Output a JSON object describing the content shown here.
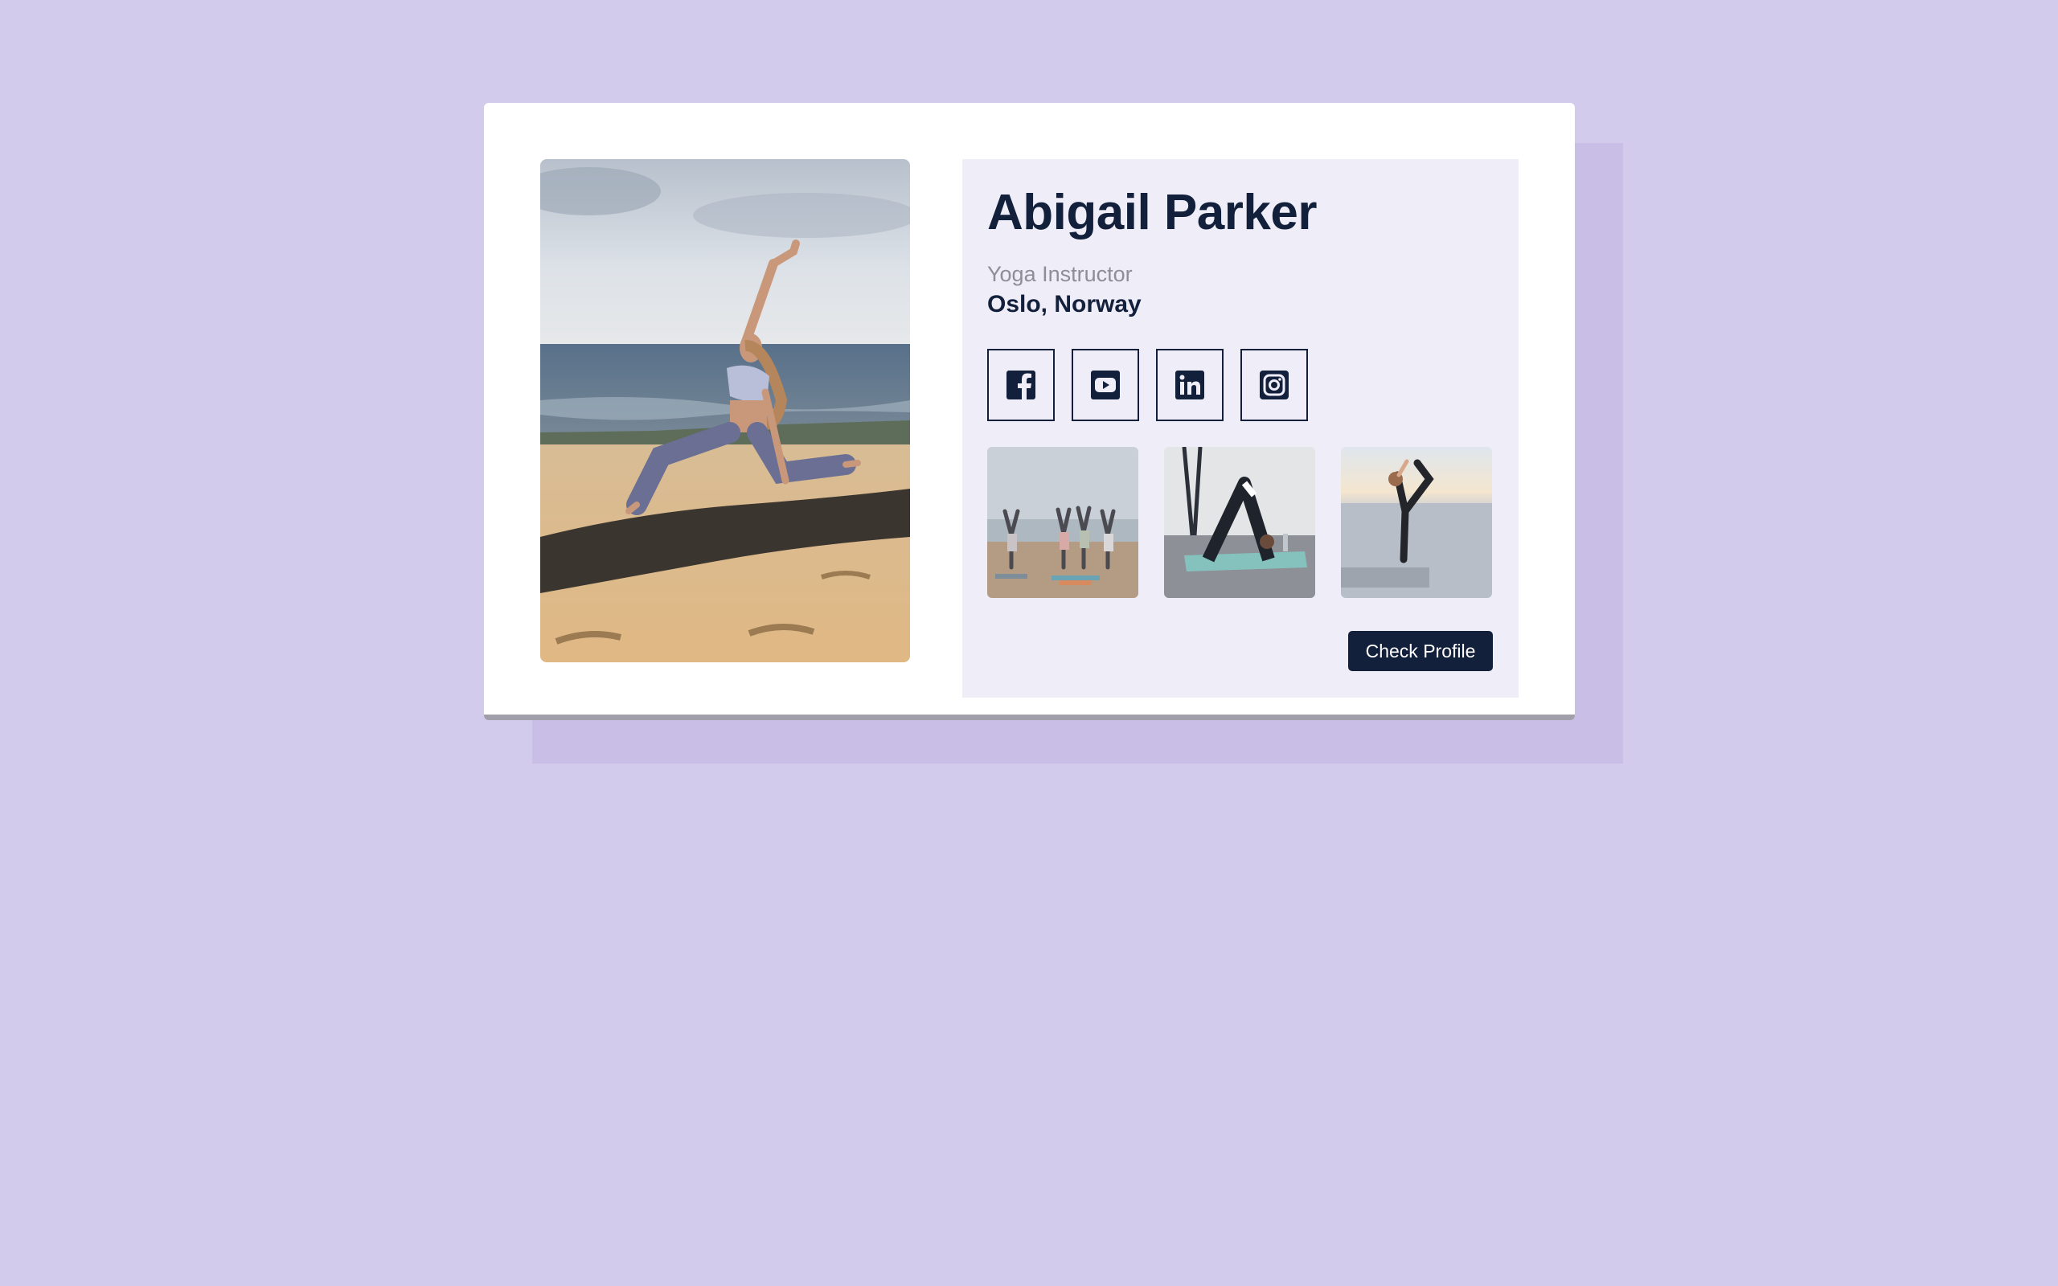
{
  "profile": {
    "name": "Abigail Parker",
    "role": "Yoga Instructor",
    "location": "Oslo, Norway"
  },
  "socials": [
    {
      "icon": "facebook-icon"
    },
    {
      "icon": "youtube-icon"
    },
    {
      "icon": "linkedin-icon"
    },
    {
      "icon": "instagram-icon"
    }
  ],
  "gallery": [
    {
      "subject": "group-tree-pose-beach-photo"
    },
    {
      "subject": "downward-dog-studio-photo"
    },
    {
      "subject": "dancer-pose-seaside-photo"
    }
  ],
  "actions": {
    "check_profile_label": "Check Profile"
  },
  "colors": {
    "background": "#d3cbec",
    "card": "#ffffff",
    "panel": "#efedf8",
    "primary": "#13203b",
    "muted": "#8e8d98"
  }
}
